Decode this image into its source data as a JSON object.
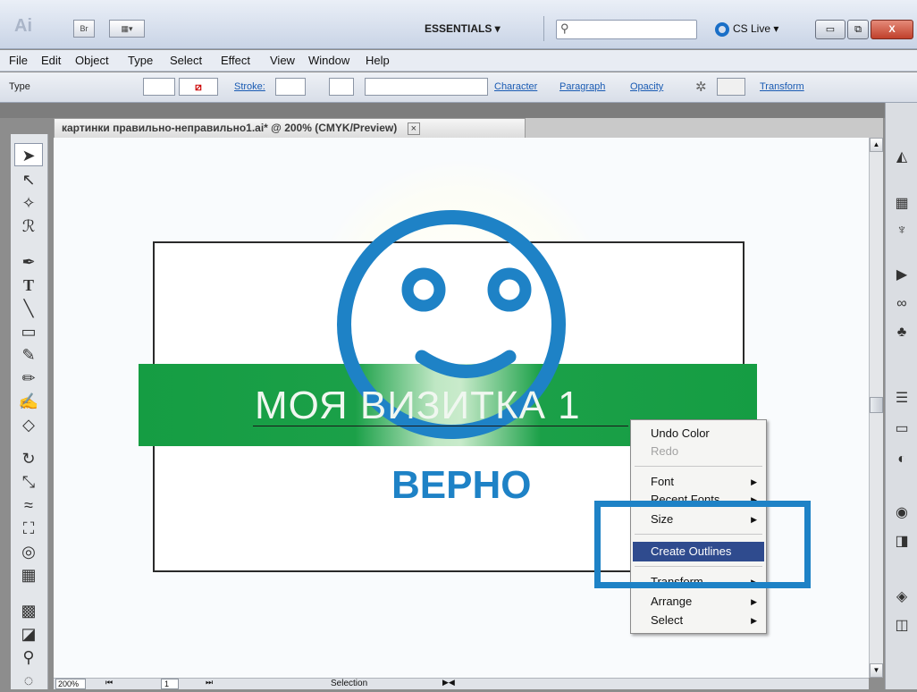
{
  "app": {
    "logo": "Ai",
    "bridge_label": "Br",
    "arrange_label": "▦▾"
  },
  "workspace": {
    "label": "ESSENTIALS ▾"
  },
  "search": {
    "placeholder": ""
  },
  "cslive": {
    "label": "CS Live ▾"
  },
  "window": {
    "minimize": "▭",
    "restore": "⧉",
    "close": "X"
  },
  "menubar": {
    "items": [
      "File",
      "Edit",
      "Object",
      "Type",
      "Select",
      "Effect",
      "View",
      "Window",
      "Help"
    ]
  },
  "controlbar": {
    "mode_label": "Type",
    "stroke_label": "Stroke:",
    "character": "Character",
    "paragraph": "Paragraph",
    "opacity": "Opacity",
    "transform": "Transform"
  },
  "document": {
    "tab_title": "картинки правильно-неправильно1.ai* @ 200% (CMYK/Preview)",
    "close_glyph": "×"
  },
  "artwork": {
    "card_title": "МОЯ ВИЗИТКА 1",
    "verdict": "ВЕРНО"
  },
  "status": {
    "zoom": "200%",
    "page": "1",
    "tool": "Selection"
  },
  "context_menu": {
    "items": [
      {
        "label": "Undo Color",
        "submenu": false,
        "disabled": false
      },
      {
        "label": "Redo",
        "submenu": false,
        "disabled": true
      },
      {
        "label": "Font",
        "submenu": true,
        "disabled": false
      },
      {
        "label": "Recent Fonts",
        "submenu": true,
        "disabled": false
      },
      {
        "label": "Size",
        "submenu": true,
        "disabled": false
      },
      {
        "label": "Create Outlines",
        "submenu": false,
        "disabled": false
      },
      {
        "label": "Transform",
        "submenu": true,
        "disabled": false
      },
      {
        "label": "Arrange",
        "submenu": true,
        "disabled": false
      },
      {
        "label": "Select",
        "submenu": true,
        "disabled": false
      }
    ]
  },
  "colors": {
    "accent_blue": "#1e82c6",
    "band_green": "#1ba048",
    "menu_highlight": "#2f4b8e"
  }
}
